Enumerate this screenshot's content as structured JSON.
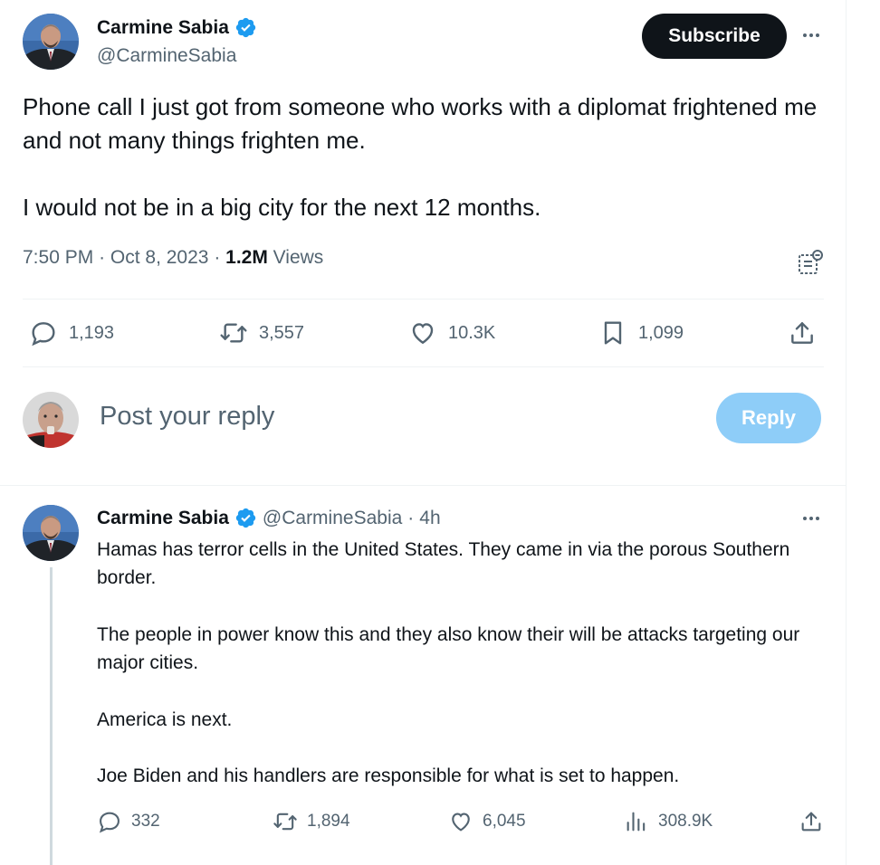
{
  "colors": {
    "text": "#0f1419",
    "secondary": "#536471",
    "verified": "#1d9bf0",
    "reply_button": "#8ecdf8",
    "subscribe_button": "#0f1419",
    "divider": "#eff3f4"
  },
  "post": {
    "author_name": "Carmine Sabia",
    "author_handle": "@CarmineSabia",
    "subscribe_label": "Subscribe",
    "text": "Phone call I just got from someone who works with a diplomat frightened me and not many things frighten me.\n\nI would not be in a big city for the next 12 months.",
    "time": "7:50 PM",
    "date": "Oct 8, 2023",
    "views_count": "1.2M",
    "views_label": "Views",
    "stats": {
      "replies": "1,193",
      "reposts": "3,557",
      "likes": "10.3K",
      "bookmarks": "1,099"
    }
  },
  "composer": {
    "placeholder": "Post your reply",
    "reply_label": "Reply"
  },
  "reply": {
    "author_name": "Carmine Sabia",
    "author_handle": "@CarmineSabia",
    "age": "4h",
    "text": "Hamas has terror cells in the United States. They came in via the porous Southern border.\n\nThe people in power know this and they also know their will be attacks targeting our major cities.\n\nAmerica is next.\n\nJoe Biden and his handlers are responsible for what is set to happen.",
    "stats": {
      "replies": "332",
      "reposts": "1,894",
      "likes": "6,045",
      "views": "308.9K"
    }
  }
}
